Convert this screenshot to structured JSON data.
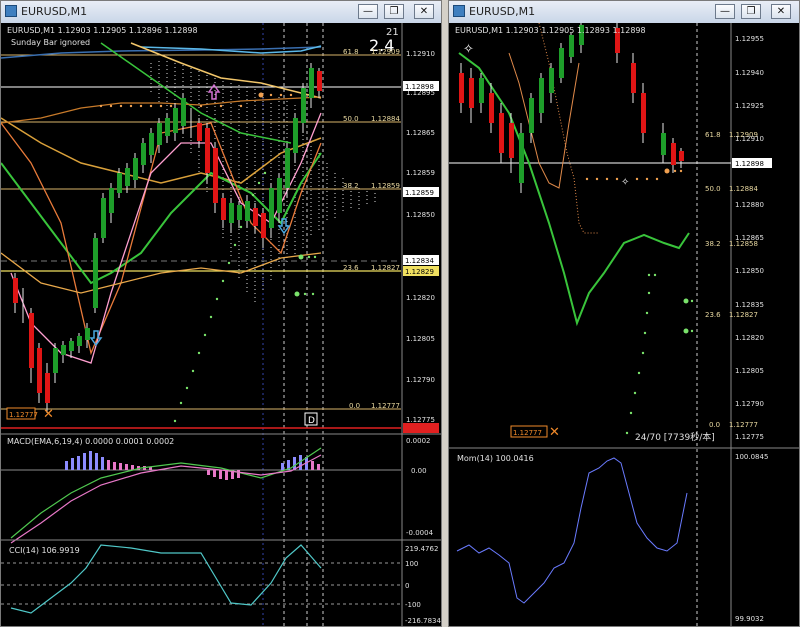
{
  "windows": {
    "left": {
      "title": "EURUSD,M1",
      "header_line": "EURUSD,M1  1.12903 1.12905 1.12896 1.12898",
      "sub_line": "Sunday Bar ignored",
      "counter_top": "21",
      "counter_big": "2.4",
      "period_marker": "D",
      "low_label": "1.12777",
      "fib": [
        {
          "level": "61.8",
          "price": "1.12909"
        },
        {
          "level": "50.0",
          "price": "1.12884"
        },
        {
          "level": "38.2",
          "price": "1.12859"
        },
        {
          "level": "23.6",
          "price": "1.12827"
        },
        {
          "level": "0.0",
          "price": "1.12777"
        }
      ],
      "price_axis": [
        "1.12910",
        "1.12898",
        "1.12895",
        "1.12880",
        "1.12865",
        "1.12859",
        "1.12850",
        "1.12834",
        "1.12829",
        "1.12820",
        "1.12805",
        "1.12790",
        "1.12775"
      ],
      "current_price": "1.12898",
      "macd": {
        "label": "MACD(EMA,6,19,4) 0.0000 0.0001 0.0002",
        "axis": [
          "0.0002",
          "0.00",
          "-0.0004"
        ]
      },
      "cci": {
        "label": "CCI(14) 106.9919",
        "axis": [
          "219.4762",
          "100",
          "0",
          "-100",
          "-216.7834"
        ]
      }
    },
    "right": {
      "title": "EURUSD,M1",
      "header_line": "EURUSD,M1  1.12903 1.12905 1.12893 1.12898",
      "low_label": "1.12777",
      "bar_info": "24/70 [7739秒/本]",
      "fib": [
        {
          "level": "61.8",
          "price": "1.12909"
        },
        {
          "level": "50.0",
          "price": "1.12884"
        },
        {
          "level": "38.2",
          "price": "1.12858"
        },
        {
          "level": "23.6",
          "price": "1.12827"
        },
        {
          "level": "0.0",
          "price": "1.12777"
        }
      ],
      "price_axis": [
        "1.12955",
        "1.12940",
        "1.12925",
        "1.12910",
        "1.12898",
        "1.12880",
        "1.12865",
        "1.12850",
        "1.12835",
        "1.12820",
        "1.12805",
        "1.12790",
        "1.12775"
      ],
      "current_price": "1.12898",
      "mom": {
        "label": "Mom(14) 100.0416",
        "axis": [
          "100.0845",
          "99.9032"
        ]
      }
    }
  },
  "buttons": {
    "minimize": "—",
    "restore": "❐",
    "close": "✕"
  },
  "colors": {
    "bull": "#1e9e2a",
    "bear": "#e01515",
    "bull_wick": "#ffffff",
    "fib": "#d9b36a",
    "ema_green": "#39c43b",
    "bands": "#f2a35a",
    "current_line": "#ffffff"
  }
}
